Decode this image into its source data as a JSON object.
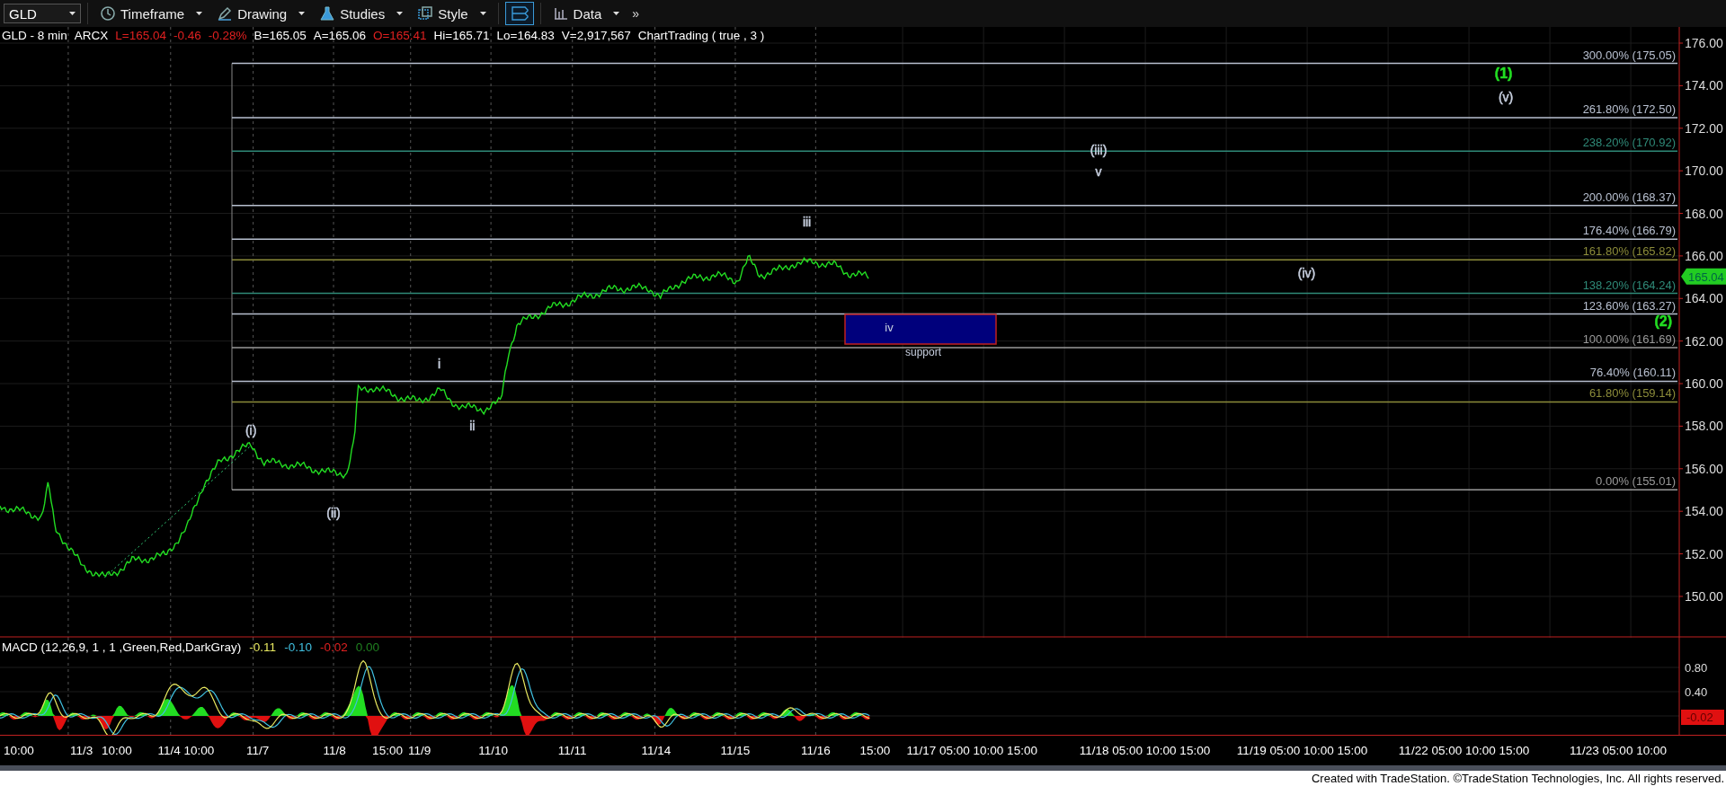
{
  "toolbar": {
    "symbol": "GLD",
    "items": [
      {
        "kind": "menu",
        "label": "Timeframe",
        "selected": false
      },
      {
        "kind": "menu",
        "label": "Drawing",
        "selected": false
      },
      {
        "kind": "menu",
        "label": "Studies",
        "selected": false
      },
      {
        "kind": "menu",
        "label": "Style",
        "selected": false
      },
      {
        "kind": "toggle",
        "selected": true
      },
      {
        "kind": "menu",
        "label": "Data",
        "selected": false
      }
    ],
    "overflow": "»"
  },
  "chart": {
    "legend": [
      {
        "text": "GLD - 8 min",
        "color": "#ffffff"
      },
      {
        "text": "ARCX",
        "color": "#ffffff"
      },
      {
        "text": "L=165.04",
        "color": "#e02020"
      },
      {
        "text": "-0.46",
        "color": "#e02020"
      },
      {
        "text": "-0.28%",
        "color": "#e02020"
      },
      {
        "text": "B=165.05",
        "color": "#ffffff"
      },
      {
        "text": "A=165.06",
        "color": "#ffffff"
      },
      {
        "text": "O=165.41",
        "color": "#e02020"
      },
      {
        "text": "Hi=165.71",
        "color": "#ffffff"
      },
      {
        "text": "Lo=164.83",
        "color": "#ffffff"
      },
      {
        "text": "V=2,917,567",
        "color": "#ffffff"
      },
      {
        "text": "ChartTrading ( true , 3 )",
        "color": "#ffffff"
      }
    ],
    "fib_levels": [
      {
        "label": "300.00% (175.05)",
        "color": "#b8c0d0"
      },
      {
        "label": "261.80% (172.50)",
        "color": "#b8c0d0"
      },
      {
        "label": "238.20% (170.92)",
        "color": "#2f8a78"
      },
      {
        "label": "200.00% (168.37)",
        "color": "#b8c0d0"
      },
      {
        "label": "176.40% (166.79)",
        "color": "#b8c0d0"
      },
      {
        "label": "161.80% (165.82)",
        "color": "#8c8c3a"
      },
      {
        "label": "138.20% (164.24)",
        "color": "#2f8a78"
      },
      {
        "label": "123.60% (163.27)",
        "color": "#b8c0d0"
      },
      {
        "label": "100.00% (161.69)",
        "color": "#9a9a9a"
      },
      {
        "label": "76.40% (160.11)",
        "color": "#b8c0d0"
      },
      {
        "label": "61.80% (159.14)",
        "color": "#8c8c3a"
      },
      {
        "label": "0.00% (155.01)",
        "color": "#9a9a9a"
      }
    ],
    "wave_labels": [
      {
        "text": "(1)",
        "color": "#22dd22"
      },
      {
        "text": "(v)",
        "color": "#c8d0e0"
      },
      {
        "text": "(iii)",
        "color": "#c8d0e0"
      },
      {
        "text": "v",
        "color": "#c8d0e0"
      },
      {
        "text": "iii",
        "color": "#c8d0e0"
      },
      {
        "text": "(iv)",
        "color": "#c8d0e0"
      },
      {
        "text": "(2)",
        "color": "#22dd22"
      },
      {
        "text": "i",
        "color": "#c8d0e0"
      },
      {
        "text": "ii",
        "color": "#c8d0e0"
      },
      {
        "text": "(i)",
        "color": "#c8d0e0"
      },
      {
        "text": "(ii)",
        "color": "#c8d0e0"
      }
    ],
    "support_zone": {
      "wave": "iv",
      "label": "support"
    },
    "price_axis": [
      "176.00",
      "174.00",
      "172.00",
      "170.00",
      "168.00",
      "166.00",
      "164.00",
      "162.00",
      "160.00",
      "158.00",
      "156.00",
      "154.00",
      "152.00",
      "150.00"
    ],
    "last_price_tag": "165.04"
  },
  "macd": {
    "title": "MACD (12,26,9, 1 , 1 ,Green,Red,DarkGray)",
    "values": [
      {
        "text": "-0.11",
        "color": "#e8e860"
      },
      {
        "text": "-0.10",
        "color": "#40c0e0"
      },
      {
        "text": "-0.02",
        "color": "#e02020"
      },
      {
        "text": "0.00",
        "color": "#208020"
      }
    ],
    "axis": [
      "0.80",
      "0.40"
    ],
    "last_value_tag": "-0.02"
  },
  "time_axis": [
    "10:00",
    "11/3",
    "10:00",
    "11/4 10:00",
    "11/7",
    "11/8",
    "15:00",
    "11/9",
    "11/10",
    "11/11",
    "11/14",
    "11/15",
    "11/16",
    "15:00",
    "11/17 05:00 10:00 15:00",
    "11/18 05:00 10:00 15:00",
    "11/19 05:00 10:00 15:00",
    "11/22 05:00 10:00 15:00",
    "11/23 05:00 10:00"
  ],
  "footer": "Created with TradeStation. ©TradeStation Technologies, Inc. All rights reserved."
}
